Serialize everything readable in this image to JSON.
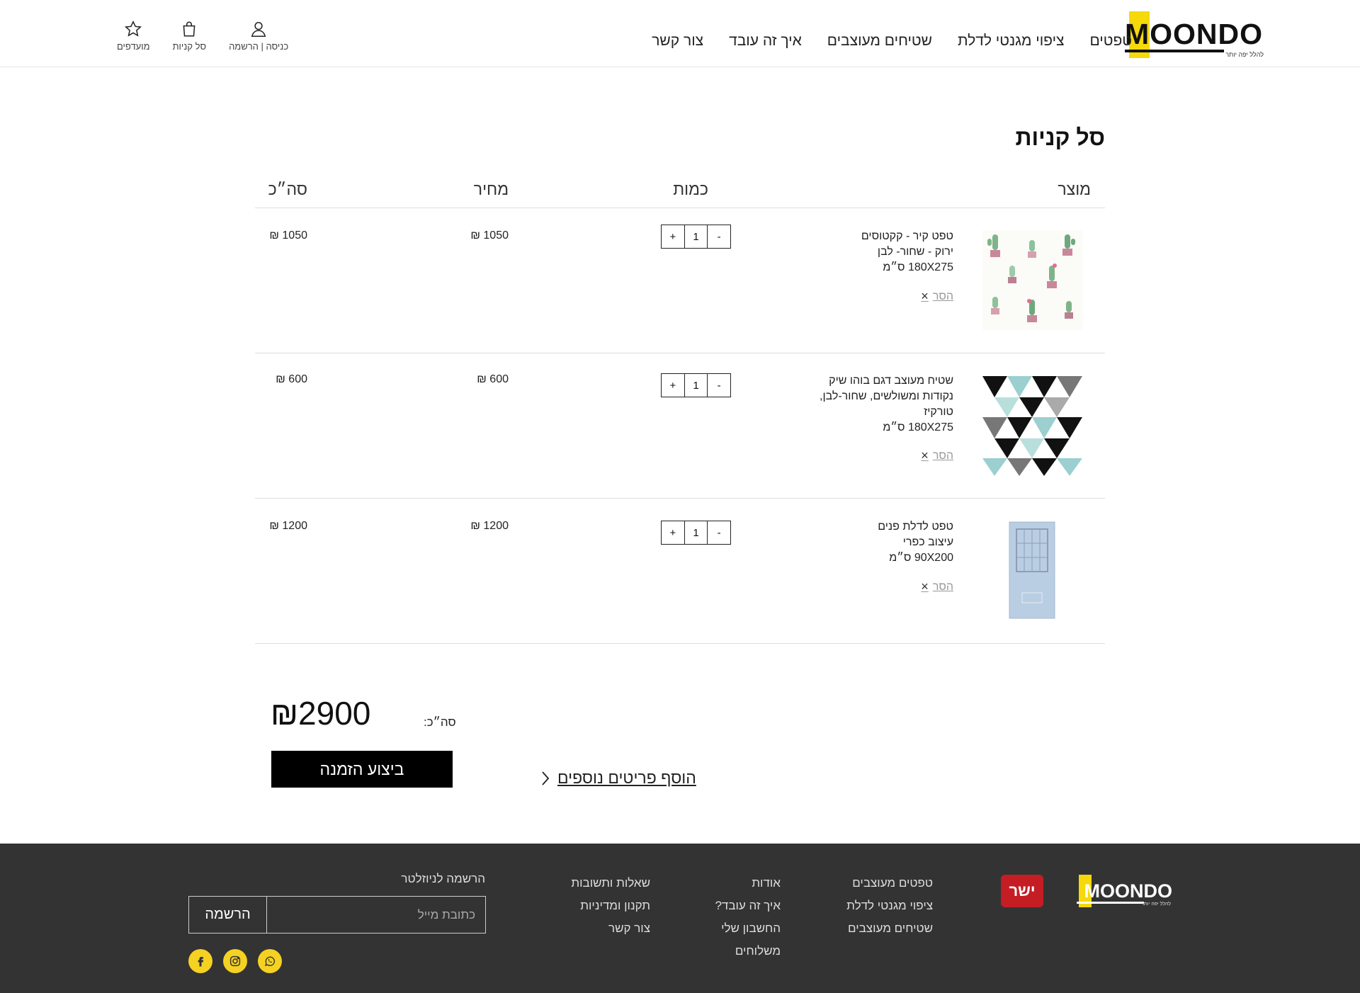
{
  "header": {
    "logo": {
      "word": "MOONDO",
      "tagline": "להלל יפה יותר"
    },
    "nav": [
      "טפטים",
      "ציפוי מגנטי לדלת",
      "שטיחים מעוצבים",
      "איך זה עובד",
      "צור קשר"
    ],
    "user_links": {
      "favorites": "מועדפים",
      "cart": "סל קניות",
      "login": "כניסה | הרשמה"
    }
  },
  "cart": {
    "title": "סל קניות",
    "columns": {
      "product": "מוצר",
      "quantity": "כמות",
      "price": "מחיר",
      "total": "סה״כ"
    },
    "remove_label": "הסר",
    "items": [
      {
        "lines": [
          "טפט קיר - קקטוסים",
          "ירוק - שחור- לבן",
          "180X275 ס״מ"
        ],
        "qty": "1",
        "price": "1050 ₪",
        "total": "1050 ₪",
        "image": "cactus-pattern"
      },
      {
        "lines": [
          "שטיח מעוצב דגם בוהו שיק",
          "נקודות ומשולשים, שחור-לבן,",
          "טורקיז",
          "180X275 ס״מ"
        ],
        "qty": "1",
        "price": "600 ₪",
        "total": "600 ₪",
        "image": "triangles-pattern"
      },
      {
        "lines": [
          "טפט לדלת פנים",
          "עיצוב כפרי",
          "90X200 ס״מ"
        ],
        "qty": "1",
        "price": "1200 ₪",
        "total": "1200 ₪",
        "image": "door-wrap"
      }
    ],
    "qty_minus": "-",
    "qty_plus": "+",
    "summary": {
      "label": "סה״כ:",
      "value": "₪2900",
      "checkout": "ביצוע הזמנה",
      "continue": "הוסף פריטים נוספים"
    }
  },
  "footer": {
    "logo": {
      "word": "MOONDO",
      "tagline": "להלל יפה יותר"
    },
    "badge": "ישר",
    "col1": [
      "טפטים מעוצבים",
      "ציפוי מגנטי לדלת",
      "שטיחים מעוצבים"
    ],
    "col2": [
      "אודות",
      "איך זה עובד?",
      "החשבון שלי",
      "משלוחים"
    ],
    "col3": [
      "שאלות ותשובות",
      "תקנון ומדיניות",
      "צור קשר"
    ],
    "newsletter": {
      "title": "הרשמה לניוזלטר",
      "placeholder": "כתובת מייל",
      "button": "הרשמה"
    },
    "socials": [
      "whatsapp-icon",
      "instagram-icon",
      "facebook-icon"
    ],
    "accent": "#f5d222"
  }
}
